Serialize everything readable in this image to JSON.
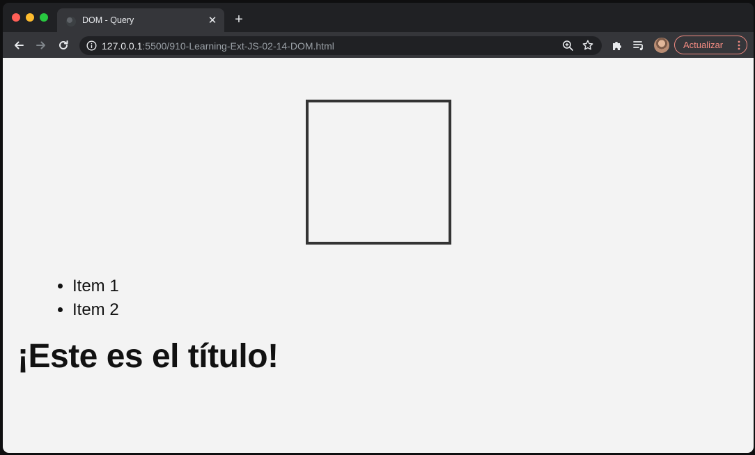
{
  "browser": {
    "tab": {
      "title": "DOM - Query"
    },
    "address": {
      "host": "127.0.0.1",
      "path": ":5500/910-Learning-Ext-JS-02-14-DOM.html"
    },
    "update_label": "Actualizar"
  },
  "page": {
    "list_items": [
      "Item 1",
      "Item 2"
    ],
    "heading": "¡Este es el título!"
  },
  "colors": {
    "page_background": "#f3f3f3",
    "box_border": "#333333",
    "update_accent": "#f28b82"
  }
}
